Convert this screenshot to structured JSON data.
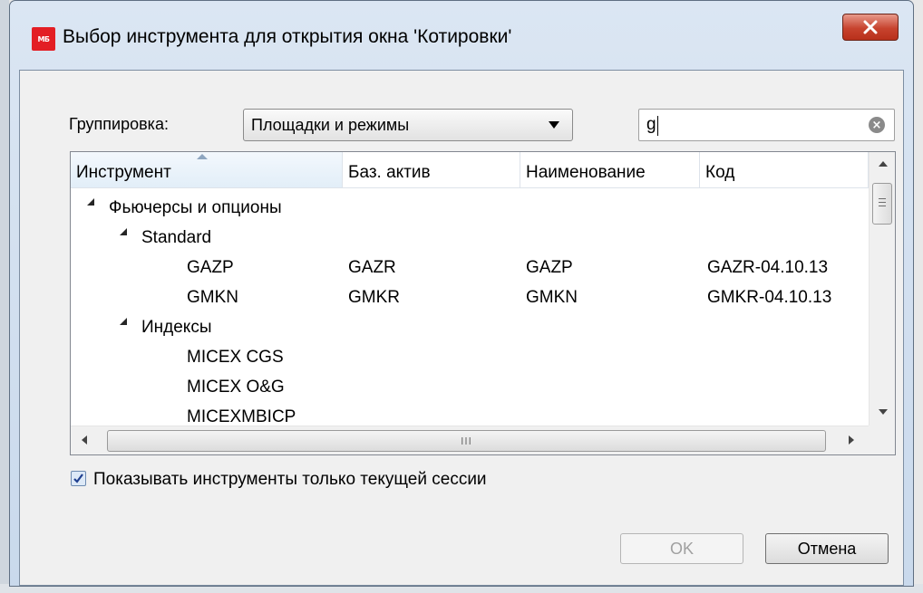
{
  "window": {
    "title": "Выбор инструмента для открытия окна 'Котировки'",
    "app_icon_text": "МБ"
  },
  "filter": {
    "group_label": "Группировка:",
    "group_value": "Площадки и режимы",
    "search_value": "g"
  },
  "grid": {
    "columns": [
      "Инструмент",
      "Баз. актив",
      "Наименование",
      "Код"
    ],
    "sorted_column": "Инструмент",
    "rows": [
      {
        "level": 0,
        "expanded": true,
        "instrument": "Фьючерсы и опционы",
        "base": "",
        "name": "",
        "code": ""
      },
      {
        "level": 1,
        "expanded": true,
        "instrument": "Standard",
        "base": "",
        "name": "",
        "code": ""
      },
      {
        "level": 2,
        "instrument": "GAZP",
        "base": "GAZR",
        "name": "GAZP",
        "code": "GAZR-04.10.13"
      },
      {
        "level": 2,
        "instrument": "GMKN",
        "base": "GMKR",
        "name": "GMKN",
        "code": "GMKR-04.10.13"
      },
      {
        "level": 1,
        "expanded": true,
        "instrument": "Индексы",
        "base": "",
        "name": "",
        "code": ""
      },
      {
        "level": 2,
        "instrument": "MICEX CGS",
        "base": "",
        "name": "",
        "code": ""
      },
      {
        "level": 2,
        "instrument": "MICEX O&G",
        "base": "",
        "name": "",
        "code": ""
      },
      {
        "level": 2,
        "instrument": "MICEXMBICP",
        "base": "",
        "name": "",
        "code": ""
      }
    ],
    "hscroll_grip": "III"
  },
  "options": {
    "current_session_only_label": "Показывать инструменты только текущей сессии",
    "current_session_only_checked": true
  },
  "buttons": {
    "ok": "OK",
    "cancel": "Отмена"
  },
  "colors": {
    "title_gradient": "#dbe6f3",
    "close_button": "#c7432e",
    "app_icon": "#e31e24",
    "client_bg": "#f0f0f0"
  }
}
